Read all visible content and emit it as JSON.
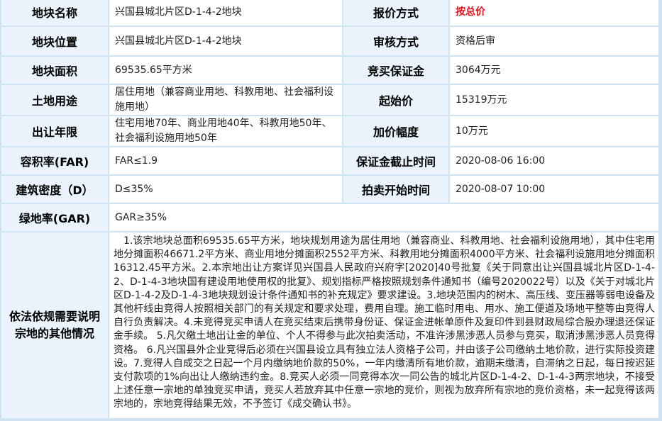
{
  "left_rows": [
    {
      "label": "地块名称",
      "value": "兴国县城北片区D-1-4-2地块"
    },
    {
      "label": "地块位置",
      "value": "兴国县城北片区D-1-4-2地块"
    },
    {
      "label": "地块面积",
      "value": "69535.65平方米"
    },
    {
      "label": "土地用途",
      "value": "居住用地（兼容商业用地、科教用地、社会福利设施用地）"
    },
    {
      "label": "出让年限",
      "value": "住宅用地70年、商业用地40年、科教用地50年、社会福利设施用地50年"
    },
    {
      "label": "容积率(FAR)",
      "value": "FAR≤1.9"
    },
    {
      "label": "建筑密度（D）",
      "value": "D≤35%"
    },
    {
      "label": "绿地率(GAR)",
      "value": "GAR≥35%"
    }
  ],
  "right_rows": [
    {
      "label": "报价方式",
      "value": "按总价"
    },
    {
      "label": "审核方式",
      "value": "资格后审"
    },
    {
      "label": "竞买保证金",
      "value": "3064万元"
    },
    {
      "label": "起始价",
      "value": "15319万元"
    },
    {
      "label": "加价幅度",
      "value": "10万元"
    },
    {
      "label": "保证金截止时间",
      "value": "2020-08-06 16:00"
    },
    {
      "label": "拍卖开始时间",
      "value": "2020-08-07 10:00"
    }
  ],
  "notes": {
    "label": "依法依规需要说明宗地的其他情况",
    "text": "1.该宗地块总面积69535.65平方米，地块规划用途为居住用地（兼容商业、科教用地、社会福利设施用地），其中住宅用地分摊面积46671.2平方米、商业用地分摊面积2552平方米、科教用地分摊面积4000平方米、社会福利设施用地分摊面积16312.45平方米。2.本宗地出让方案详见兴国县人民政府兴府字[2020]40号批复《关于同意出让兴国县城北片区D-1-4-2、D-1-4-3地块国有建设用地使用权的批复》、规划指标严格按照规划条件通知书（编号2020022号）以及《关于对城北片区D-1-4-2及D-1-4-3地块规划设计条件通知书的补充规定》要求建设。3.地块范围内的树木、高压线、变压器等弱电设备及其他杆线由竞得人按照相关部门的有关规定和要求处理，费用自理。施工临时用电、用水、施工便道及场地平整等由竞得人自行负责解决。4.未竞得竞买申请人在竞买结束后携带身份证、保证金进帐单原件及复印件到县财政局综合股办理退还保证金手续。 5.凡欠缴土地出让金的单位、个人不得参与此次拍卖活动，不准许涉黑涉恶人员参与竞买，取消涉黑涉恶人员竞得资格。 6.凡兴国县外企业竞得后必须在兴国县设立具有独立法人资格子公司，并由该子公司缴纳土地价款，进行实际投资建设。7.竞得人自成交之日起一个月内缴纳地价款的50%，一年内缴清所有地价款，逾期未缴清，自滞纳之日起，每日按迟延支付款项的1%向出让人缴纳违约金。8.竞买人必须一同竞得本次一同公告的城北片区D-1-4-2、D-1-4-3两宗地块，不接受上述任意一宗地的单独竞买申请，竞买人若放弃其中任意一宗地的竞价，则视为放弃所有宗地的竞价资格，未一起竞得该两宗地的，宗地竞得结果无效，不予签订《成交确认书》。"
  }
}
